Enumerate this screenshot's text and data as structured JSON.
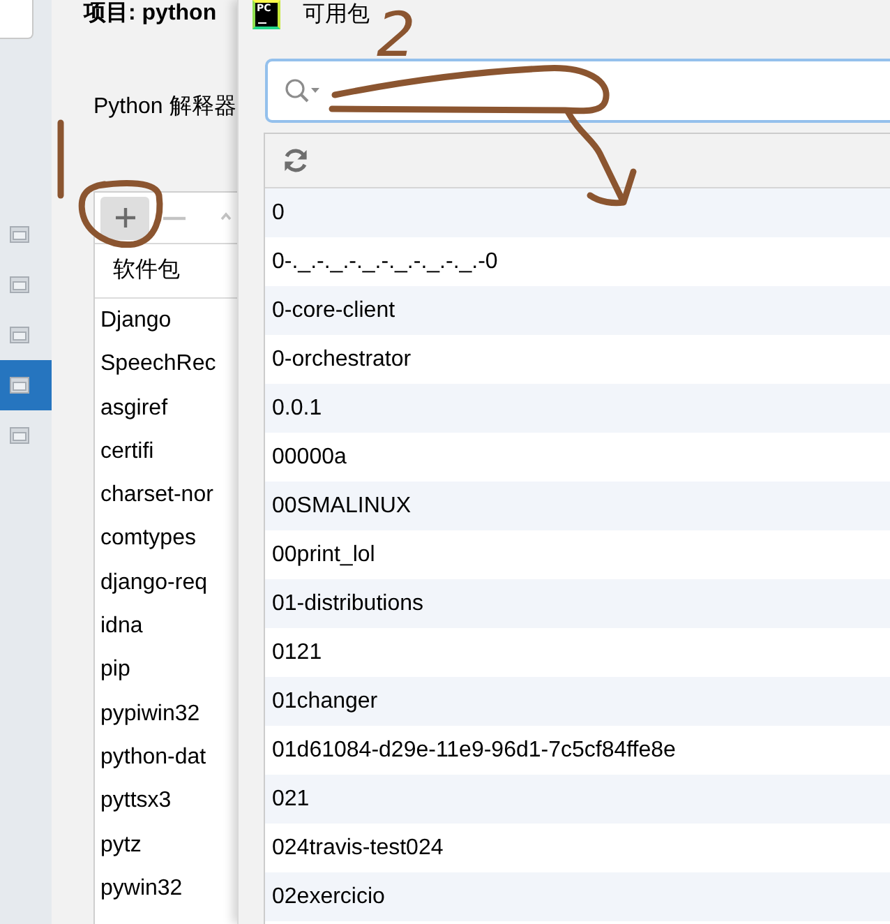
{
  "sidebar": {
    "items": [
      {
        "selected": false
      },
      {
        "selected": false
      },
      {
        "selected": false
      },
      {
        "selected": true
      },
      {
        "selected": false
      }
    ]
  },
  "settings": {
    "title": "项目: python",
    "section": "Python 解释器",
    "toolbar": [
      {
        "kind": "add",
        "disabled": false
      },
      {
        "kind": "remove",
        "disabled": true
      },
      {
        "kind": "up",
        "disabled": true
      }
    ],
    "table": {
      "columns": [
        "软件包"
      ],
      "rows": [
        "Django",
        "SpeechRec",
        "asgiref",
        "certifi",
        "charset-nor",
        "comtypes",
        "django-req",
        "idna",
        "pip",
        "pypiwin32",
        "python-dat",
        "pyttsx3",
        "pytz",
        "pywin32"
      ]
    }
  },
  "dialog": {
    "logo": "PC",
    "title": "可用包",
    "packages": [
      "0",
      "0-._.-._.-._.-._.-._.-._.-0",
      "0-core-client",
      "0-orchestrator",
      "0.0.1",
      "00000a",
      "00SMALINUX",
      "00print_lol",
      "01-distributions",
      "0121",
      "01changer",
      "01d61084-d29e-11e9-96d1-7c5cf84ffe8e",
      "021",
      "024travis-test024",
      "02exercicio"
    ]
  },
  "annotations": [
    {
      "kind": "number",
      "text": "2"
    },
    {
      "kind": "scribble"
    },
    {
      "kind": "arrow"
    },
    {
      "kind": "line"
    },
    {
      "kind": "circle"
    }
  ]
}
